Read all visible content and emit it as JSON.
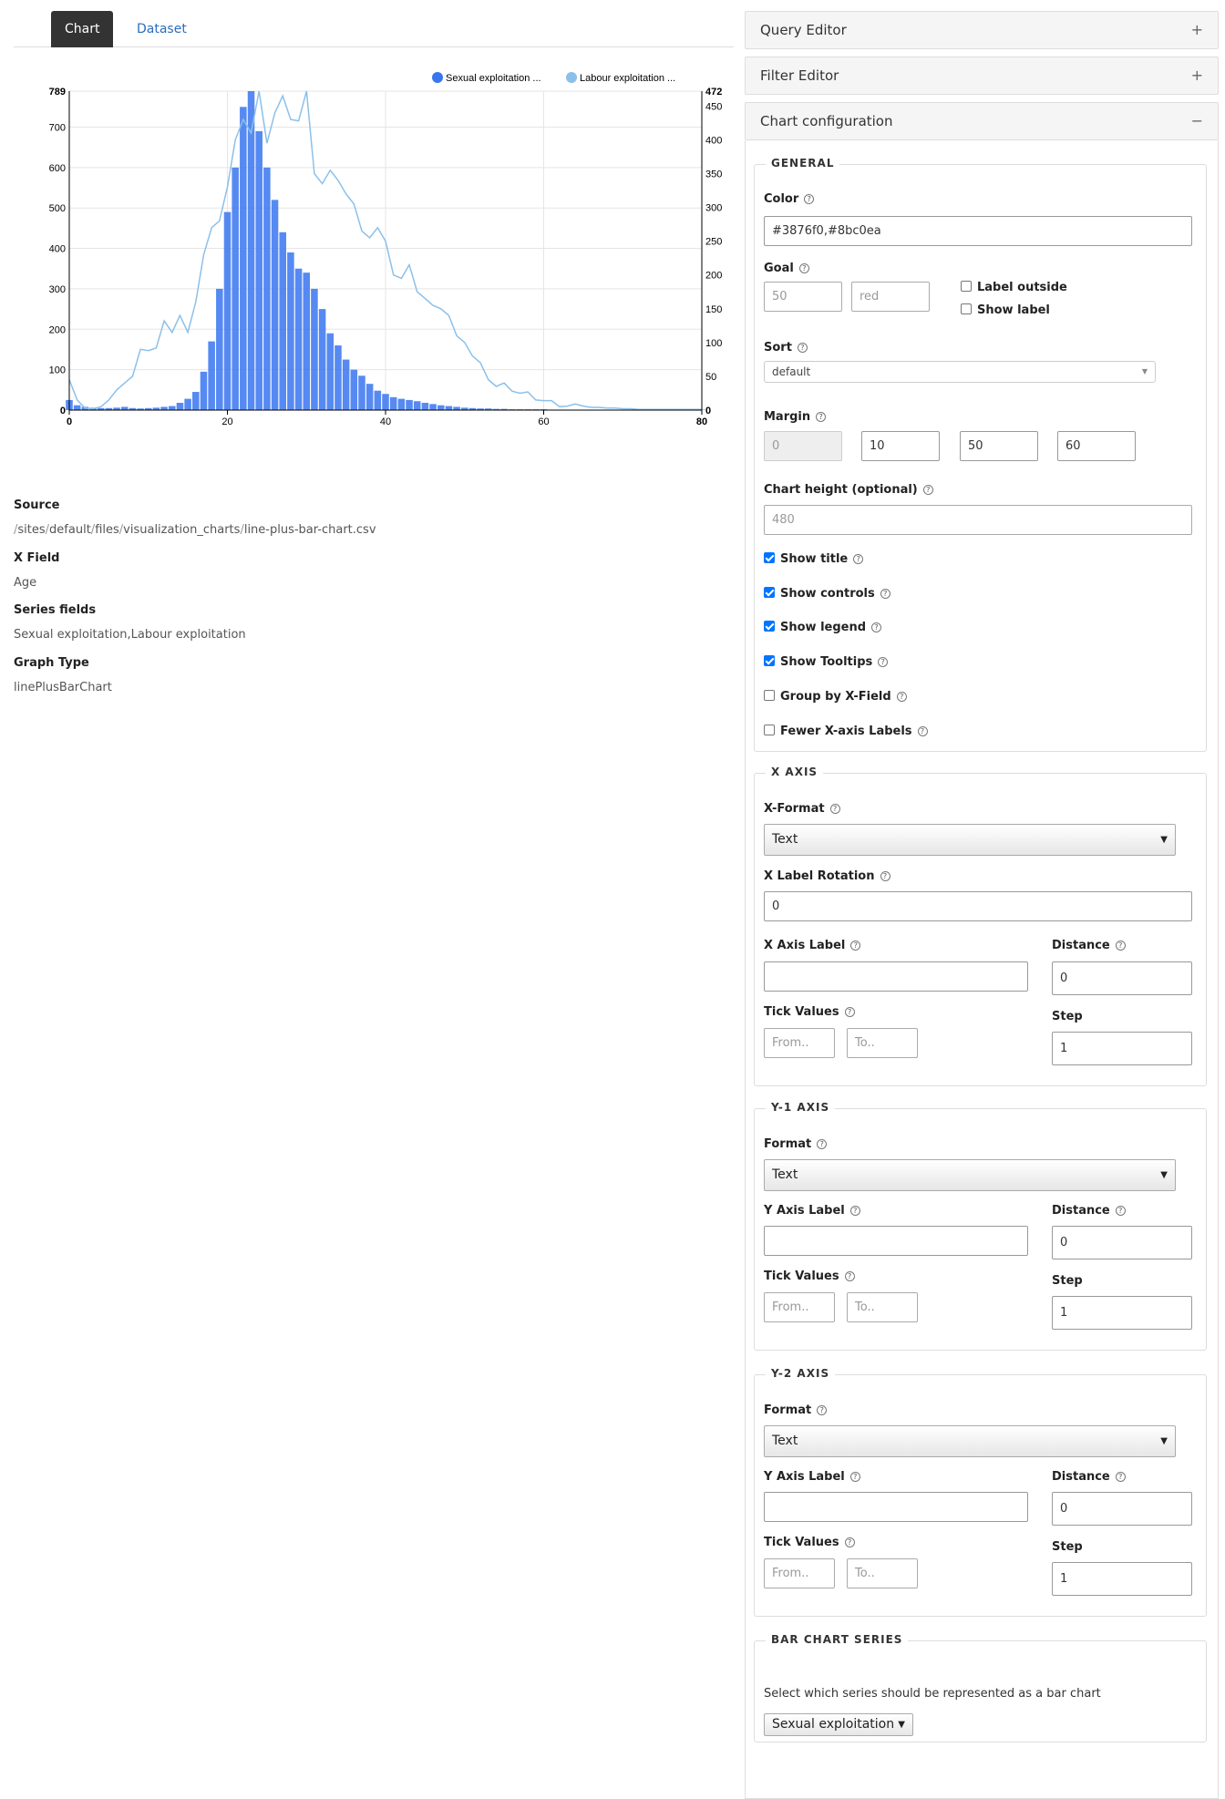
{
  "tabs": {
    "chart": "Chart",
    "dataset": "Dataset"
  },
  "chart_data": {
    "type": "line+bar",
    "x": [
      0,
      1,
      2,
      3,
      4,
      5,
      6,
      7,
      8,
      9,
      10,
      11,
      12,
      13,
      14,
      15,
      16,
      17,
      18,
      19,
      20,
      21,
      22,
      23,
      24,
      25,
      26,
      27,
      28,
      29,
      30,
      31,
      32,
      33,
      34,
      35,
      36,
      37,
      38,
      39,
      40,
      41,
      42,
      43,
      44,
      45,
      46,
      47,
      48,
      49,
      50,
      51,
      52,
      53,
      54,
      55,
      56,
      57,
      58,
      59,
      60,
      61,
      62,
      63,
      64,
      65,
      66,
      67,
      68,
      69,
      70,
      71,
      72,
      73,
      74,
      75,
      76,
      77,
      78,
      79,
      80
    ],
    "series": [
      {
        "name": "Sexual exploitation ...",
        "axis": "y1",
        "render": "bar",
        "color": "#3876f0",
        "values": [
          25,
          12,
          8,
          6,
          5,
          5,
          6,
          8,
          5,
          4,
          5,
          6,
          8,
          10,
          18,
          28,
          45,
          95,
          170,
          300,
          490,
          600,
          750,
          789,
          690,
          600,
          520,
          440,
          390,
          350,
          340,
          300,
          250,
          190,
          160,
          125,
          100,
          85,
          65,
          48,
          40,
          32,
          28,
          25,
          22,
          18,
          15,
          12,
          10,
          8,
          6,
          5,
          4,
          4,
          3,
          3,
          2,
          2,
          2,
          2,
          2,
          1,
          1,
          1,
          1,
          1,
          1,
          1,
          1,
          1,
          1,
          1,
          1,
          1,
          1,
          1,
          1,
          1,
          1,
          1,
          1
        ]
      },
      {
        "name": "Labour exploitation ...",
        "axis": "y2",
        "render": "line",
        "color": "#8bc0ea",
        "values": [
          45,
          15,
          3,
          2,
          5,
          15,
          30,
          40,
          50,
          90,
          88,
          92,
          132,
          115,
          140,
          115,
          160,
          230,
          270,
          280,
          330,
          400,
          430,
          410,
          472,
          395,
          440,
          465,
          430,
          428,
          472,
          350,
          335,
          355,
          340,
          320,
          305,
          265,
          255,
          270,
          250,
          200,
          195,
          215,
          175,
          165,
          155,
          150,
          140,
          110,
          100,
          80,
          70,
          45,
          35,
          40,
          28,
          25,
          27,
          15,
          14,
          14,
          5,
          6,
          9,
          6,
          4,
          4,
          3,
          3,
          2,
          2,
          1,
          1,
          1,
          1,
          1,
          1,
          1,
          1,
          1
        ]
      }
    ],
    "y1_ticks": [
      "0",
      "100",
      "200",
      "300",
      "400",
      "500",
      "600",
      "700",
      "789"
    ],
    "y1_tick_values": [
      0,
      100,
      200,
      300,
      400,
      500,
      600,
      700,
      789
    ],
    "y2_ticks": [
      "0",
      "50",
      "100",
      "150",
      "200",
      "250",
      "300",
      "350",
      "400",
      "450",
      "472"
    ],
    "y2_tick_values": [
      0,
      50,
      100,
      150,
      200,
      250,
      300,
      350,
      400,
      450,
      472
    ],
    "x_ticks": [
      "0",
      "20",
      "40",
      "60",
      "80"
    ],
    "x_tick_values": [
      0,
      20,
      40,
      60,
      80
    ],
    "xlim": [
      0,
      80
    ],
    "y1lim": [
      0,
      789
    ],
    "y2lim": [
      0,
      472
    ],
    "grid": true,
    "legend_position": "top-right"
  },
  "meta": {
    "source_label": "Source",
    "source_parts": [
      "/sites",
      "/default",
      "/files",
      "/visualization_charts",
      "/line-plus-bar-chart.csv"
    ],
    "xfield_label": "X Field",
    "xfield_value": "Age",
    "series_label": "Series fields",
    "series_value": "Sexual exploitation,Labour exploitation",
    "graph_label": "Graph Type",
    "graph_value": "linePlusBarChart"
  },
  "panels": {
    "query": "Query Editor",
    "filter": "Filter Editor",
    "config": "Chart configuration",
    "plus": "+",
    "minus": "−"
  },
  "general": {
    "legend": "GENERAL",
    "color_label": "Color",
    "color_value": "#3876f0,#8bc0ea",
    "goal_label": "Goal",
    "goal_value_ph": "50",
    "goal_color_ph": "red",
    "label_outside": "Label outside",
    "show_label": "Show label",
    "sort_label": "Sort",
    "sort_value": "default",
    "margin_label": "Margin",
    "margin_values": [
      "0",
      "10",
      "50",
      "60"
    ],
    "height_label": "Chart height (optional)",
    "height_ph": "480",
    "show_title": "Show title",
    "show_controls": "Show controls",
    "show_legend": "Show legend",
    "show_tooltips": "Show Tooltips",
    "group_by": "Group by X-Field",
    "fewer_labels": "Fewer X-axis Labels"
  },
  "xaxis": {
    "legend": "X AXIS",
    "format_label": "X-Format",
    "format_value": "Text",
    "rotation_label": "X Label Rotation",
    "rotation_value": "0",
    "axis_label": "X Axis Label",
    "distance_label": "Distance",
    "distance_value": "0",
    "tick_label": "Tick Values",
    "from_ph": "From..",
    "to_ph": "To..",
    "step_label": "Step",
    "step_value": "1"
  },
  "y1axis": {
    "legend": "Y-1 AXIS",
    "format_label": "Format",
    "format_value": "Text",
    "axis_label": "Y Axis Label",
    "distance_label": "Distance",
    "distance_value": "0",
    "tick_label": "Tick Values",
    "from_ph": "From..",
    "to_ph": "To..",
    "step_label": "Step",
    "step_value": "1"
  },
  "y2axis": {
    "legend": "Y-2 AXIS",
    "format_label": "Format",
    "format_value": "Text",
    "axis_label": "Y Axis Label",
    "distance_label": "Distance",
    "distance_value": "0",
    "tick_label": "Tick Values",
    "from_ph": "From..",
    "to_ph": "To..",
    "step_label": "Step",
    "step_value": "1"
  },
  "barseries": {
    "legend": "BAR CHART SERIES",
    "desc": "Select which series should be represented as a bar chart",
    "value": "Sexual exploitation"
  },
  "icons": {
    "help": "?",
    "arrow": "▼",
    "small_arrow": "▼"
  }
}
